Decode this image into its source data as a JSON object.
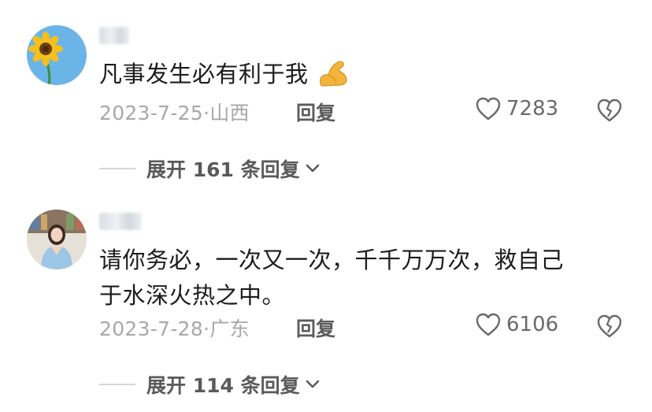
{
  "comments": [
    {
      "text_lines": [
        "凡事发生必有利于我"
      ],
      "emoji": "muscle-icon",
      "date": "2023-7-25",
      "location": "山西",
      "reply_label": "回复",
      "likes": "7283",
      "expand_label": "展开 161 条回复"
    },
    {
      "text_lines": [
        "请你务必，一次又一次，千千万万次，救自己",
        "于水深火热之中。"
      ],
      "date": "2023-7-28",
      "location": "广东",
      "reply_label": "回复",
      "likes": "6106",
      "expand_label": "展开 114 条回复"
    }
  ],
  "meta_separator": "·",
  "colors": {
    "meta_gray": "#a8a8a8",
    "text": "#1c1c1c",
    "sky_blue": "#6ab4e8",
    "sunflower": "#f3b81a"
  }
}
